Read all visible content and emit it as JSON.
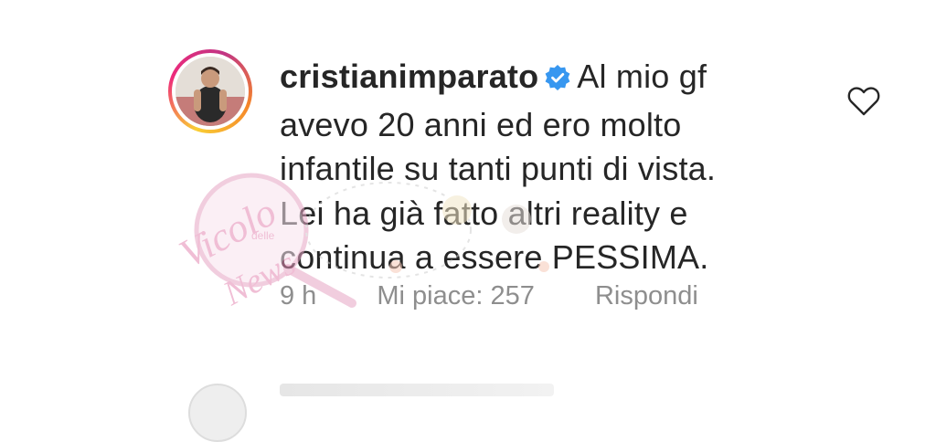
{
  "comment": {
    "username": "cristianimparato",
    "verified": true,
    "text_lines": [
      "Al mio gf",
      "avevo 20 anni ed ero molto",
      "infantile su tanti punti di vista.",
      "Lei ha già fatto altri reality e",
      "continua a essere PESSIMA."
    ],
    "time": "9 h",
    "likes_label": "Mi piace: 257",
    "reply_label": "Rispondi"
  },
  "icons": {
    "verified": "verified-badge-icon",
    "like": "heart-outline-icon"
  },
  "watermark": {
    "line1": "Vicolo",
    "line2": "delle",
    "line3": "News"
  },
  "colors": {
    "text": "#262626",
    "meta": "#8e8e8e",
    "verified_blue": "#3797f0"
  }
}
